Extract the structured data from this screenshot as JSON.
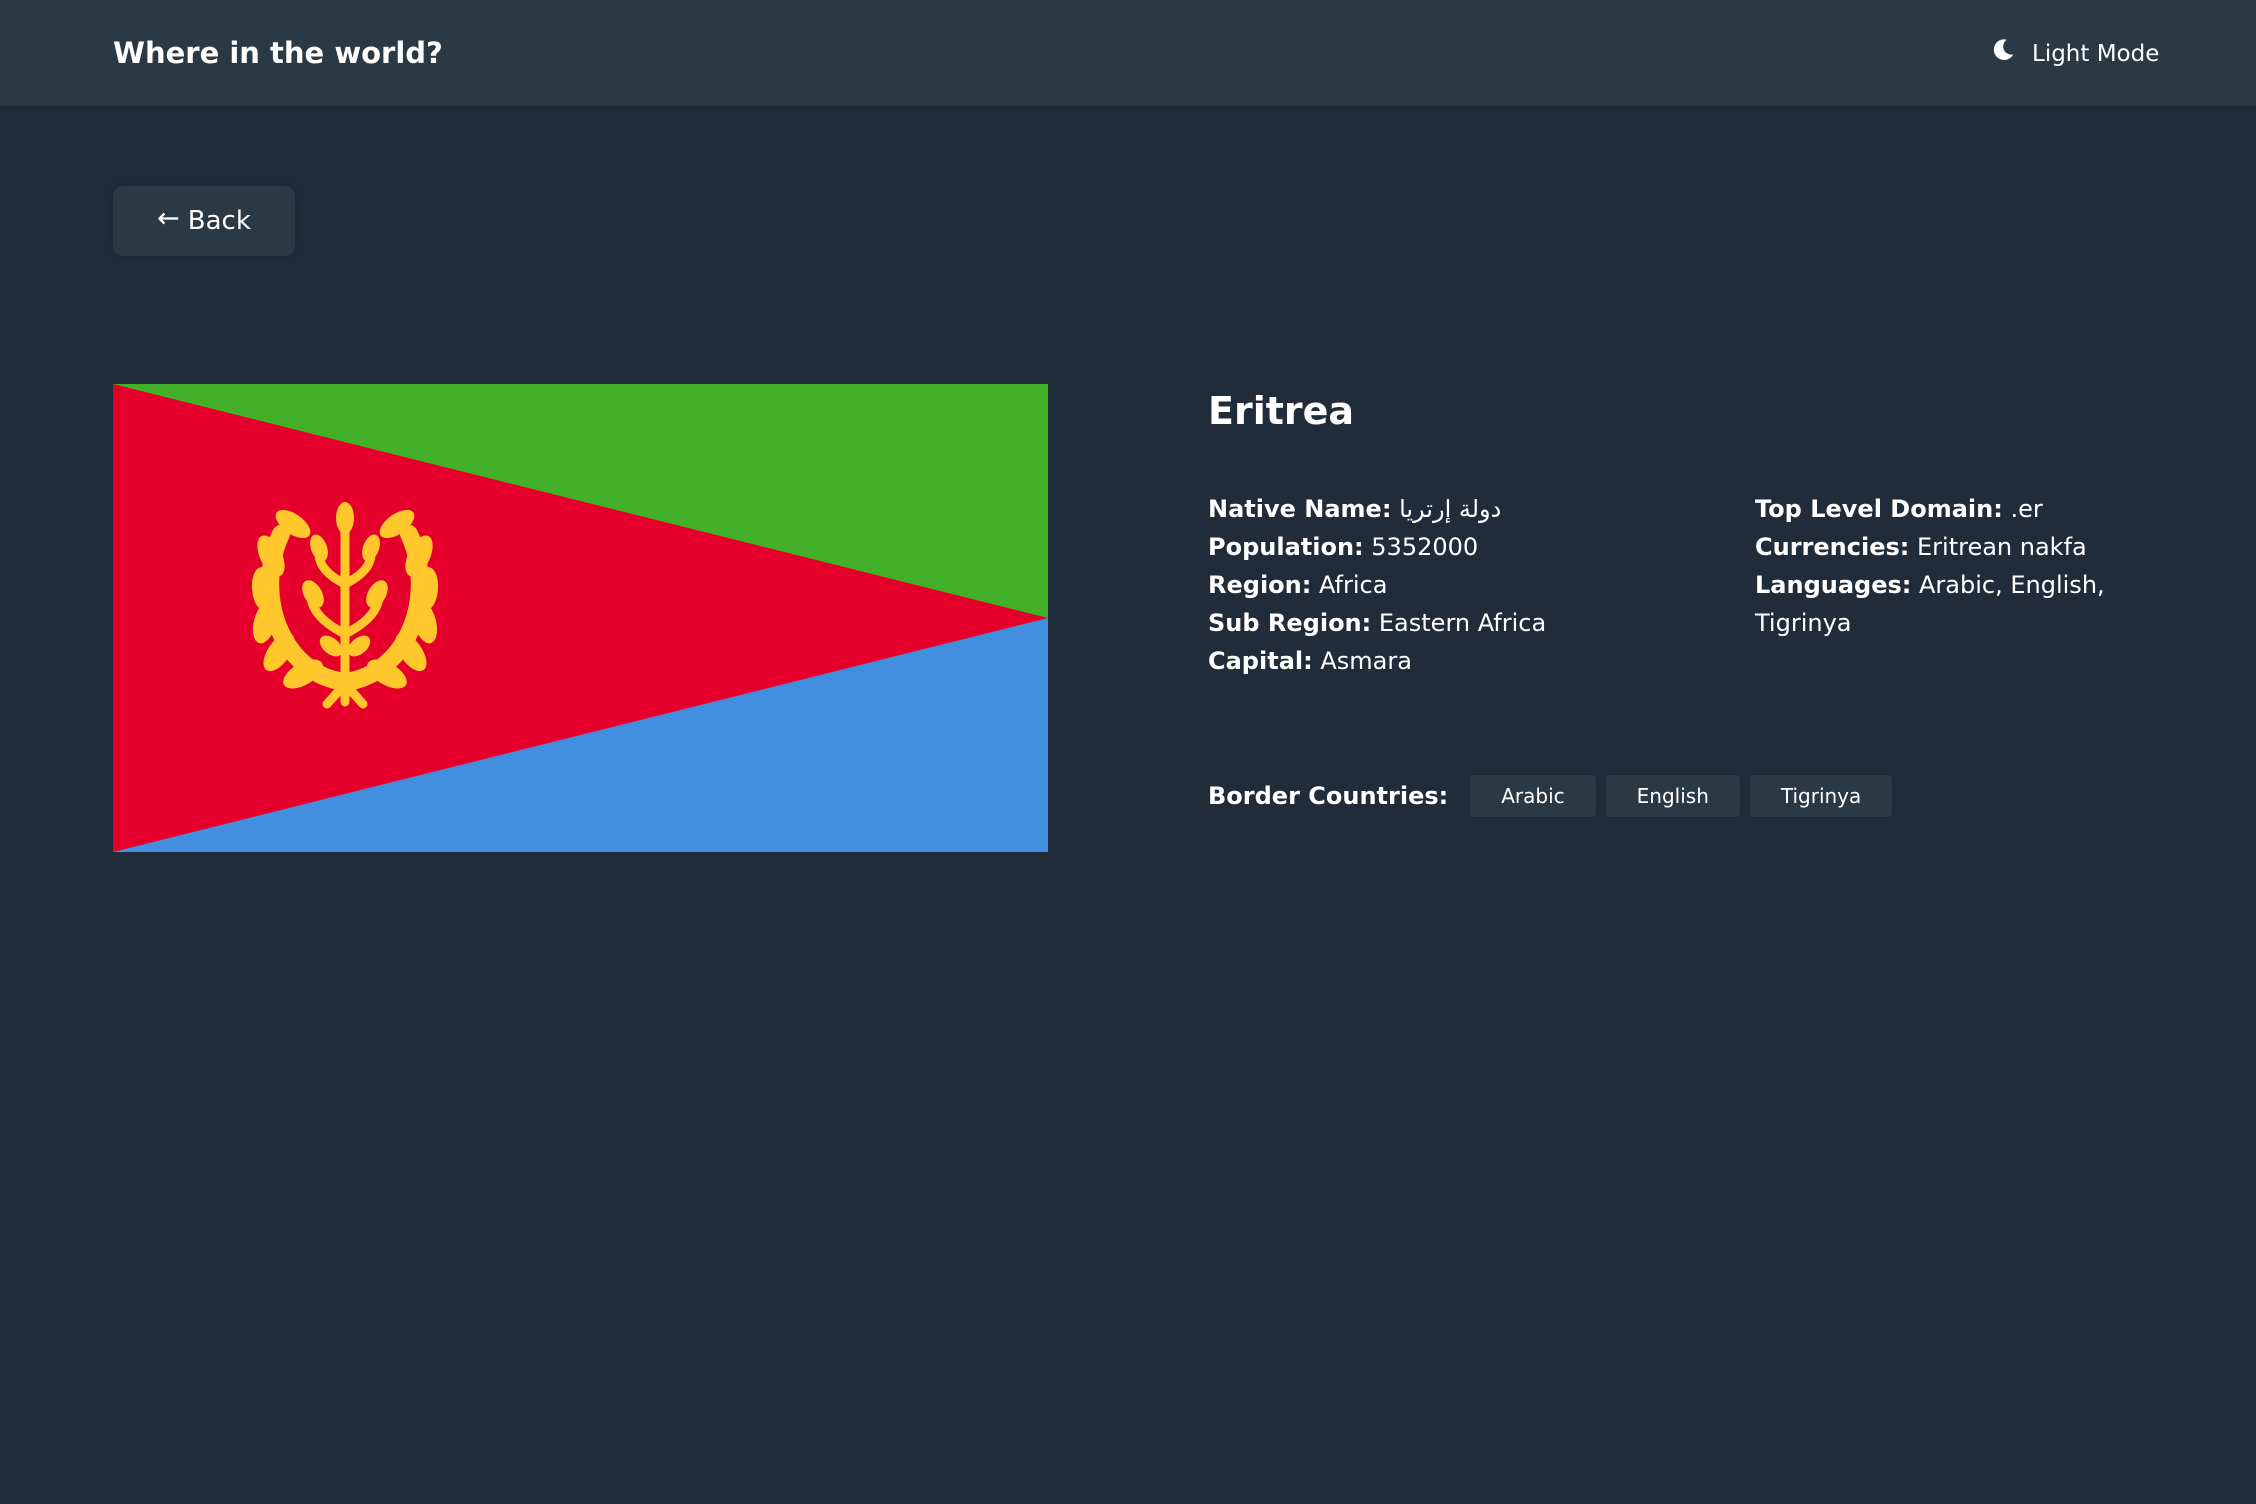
{
  "header": {
    "title": "Where in the world?",
    "mode_label": "Light Mode",
    "mode_icon": "moon-icon"
  },
  "back_button": {
    "arrow": "←",
    "label": "Back"
  },
  "country": {
    "name": "Eritrea",
    "flag": {
      "colors": {
        "green": "#43b02a",
        "red": "#e4002b",
        "blue": "#418fde",
        "emblem": "#ffc72c"
      }
    },
    "details_left": [
      {
        "label": "Native Name:",
        "value": "دولة إرتريا"
      },
      {
        "label": "Population:",
        "value": "5352000"
      },
      {
        "label": "Region:",
        "value": "Africa"
      },
      {
        "label": "Sub Region:",
        "value": "Eastern Africa"
      },
      {
        "label": "Capital:",
        "value": "Asmara"
      }
    ],
    "details_right": [
      {
        "label": "Top Level Domain:",
        "value": ".er"
      },
      {
        "label": "Currencies:",
        "value": "Eritrean nakfa"
      },
      {
        "label": "Languages:",
        "value": "Arabic, English, Tigrinya"
      }
    ],
    "border_label": "Border Countries:",
    "border_countries": [
      "Arabic",
      "English",
      "Tigrinya"
    ]
  },
  "theme": {
    "background": "#202c3a",
    "element": "#2b3945",
    "text": "#ffffff"
  }
}
